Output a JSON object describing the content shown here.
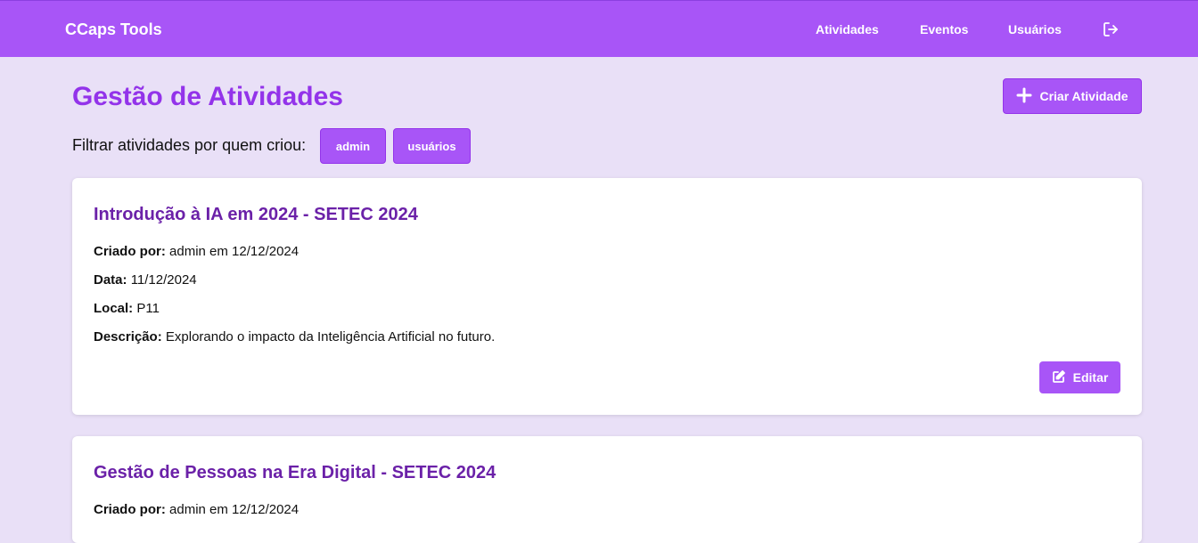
{
  "navbar": {
    "brand": "CCaps Tools",
    "links": [
      "Atividades",
      "Eventos",
      "Usuários"
    ],
    "logout_icon": "logout-icon"
  },
  "header": {
    "title": "Gestão de Atividades",
    "create_button": "Criar Atividade",
    "create_icon": "plus-icon"
  },
  "filter": {
    "label": "Filtrar atividades por quem criou:",
    "options": [
      "admin",
      "usuários"
    ]
  },
  "activities": [
    {
      "title": "Introdução à IA em 2024 - SETEC 2024",
      "created_label": "Criado por:",
      "created_value": "admin em 12/12/2024",
      "date_label": "Data:",
      "date_value": "11/12/2024",
      "place_label": "Local:",
      "place_value": "P11",
      "desc_label": "Descrição:",
      "desc_value": "Explorando o impacto da Inteligência Artificial no futuro.",
      "edit_label": "Editar"
    },
    {
      "title": "Gestão de Pessoas na Era Digital - SETEC 2024",
      "created_label": "Criado por:",
      "created_value": "admin em 12/12/2024"
    }
  ],
  "colors": {
    "primary": "#a855f7",
    "title": "#9333ea",
    "card_title": "#6b21a8",
    "background": "#e9e0f7"
  }
}
